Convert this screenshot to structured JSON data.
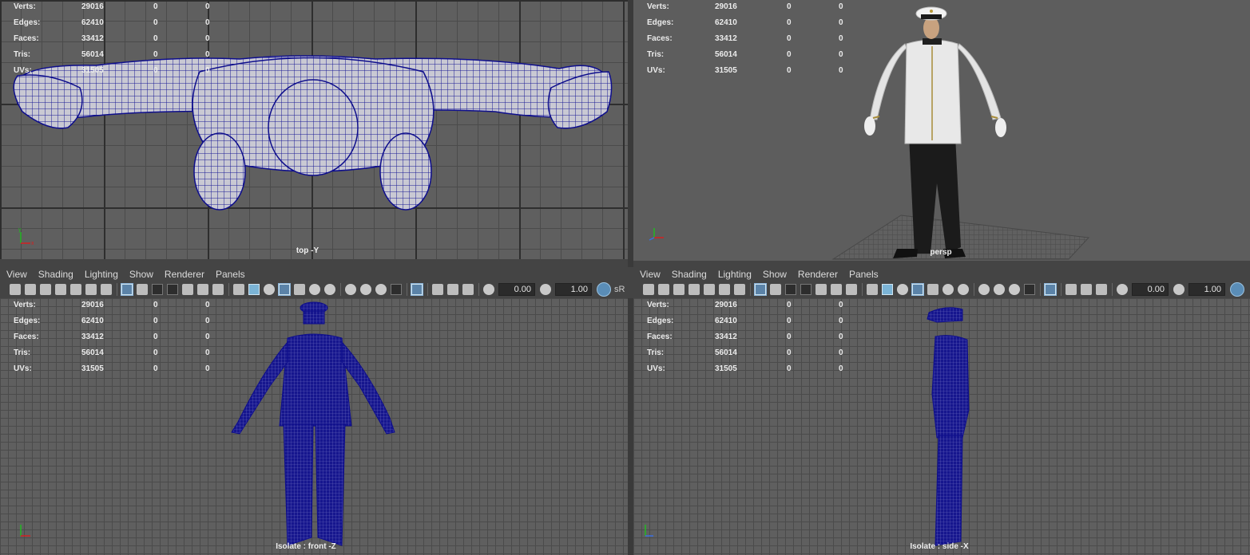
{
  "hud": {
    "rows": [
      {
        "label": "Verts:",
        "v1": "29016",
        "v2": "0",
        "v3": "0"
      },
      {
        "label": "Edges:",
        "v1": "62410",
        "v2": "0",
        "v3": "0"
      },
      {
        "label": "Faces:",
        "v1": "33412",
        "v2": "0",
        "v3": "0"
      },
      {
        "label": "Tris:",
        "v1": "56014",
        "v2": "0",
        "v3": "0"
      },
      {
        "label": "UVs:",
        "v1": "31505",
        "v2": "0",
        "v3": "0"
      }
    ]
  },
  "viewports": {
    "top": {
      "camera_label": "top -Y"
    },
    "persp": {
      "camera_label": "persp"
    },
    "front": {
      "camera_label": "Isolate : front -Z"
    },
    "side": {
      "camera_label": "Isolate : side -X"
    }
  },
  "menu": {
    "view": "View",
    "shading": "Shading",
    "lighting": "Lighting",
    "show": "Show",
    "renderer": "Renderer",
    "panels": "Panels"
  },
  "toolbar": {
    "exposure_value": "0.00",
    "gamma_value": "1.00",
    "color_space_label": "sR"
  },
  "axis": {
    "x": "x",
    "y": "y",
    "z": "z"
  },
  "colors": {
    "wireframe": "#0e0e8c",
    "viewport_bg": "#5f5f5f",
    "grid_lines": "#4b4b4b",
    "axis_x": "#d42020",
    "axis_y": "#22b922",
    "axis_z": "#3a6fe0"
  },
  "icons": [
    "camera-icon",
    "lock-camera-icon",
    "bookmark-icon",
    "select-camera-icon",
    "snap-icon",
    "move-icon",
    "paint-icon",
    "grid-icon",
    "film-gate-icon",
    "resolution-gate-icon",
    "gate-mask-icon",
    "field-chart-icon",
    "safe-action-icon",
    "safe-title-icon",
    "wireframe-icon",
    "smooth-shade-icon",
    "default-material-icon",
    "shaded-wireframe-icon",
    "textured-icon",
    "lights-icon",
    "shadows-icon",
    "ambient-occlusion-icon",
    "motion-blur-icon",
    "antialiasing-icon",
    "depth-of-field-icon",
    "isolate-select-icon",
    "xray-icon",
    "xray-active-icon",
    "xray-joints-icon",
    "exposure-icon",
    "gamma-icon",
    "color-management-icon"
  ]
}
